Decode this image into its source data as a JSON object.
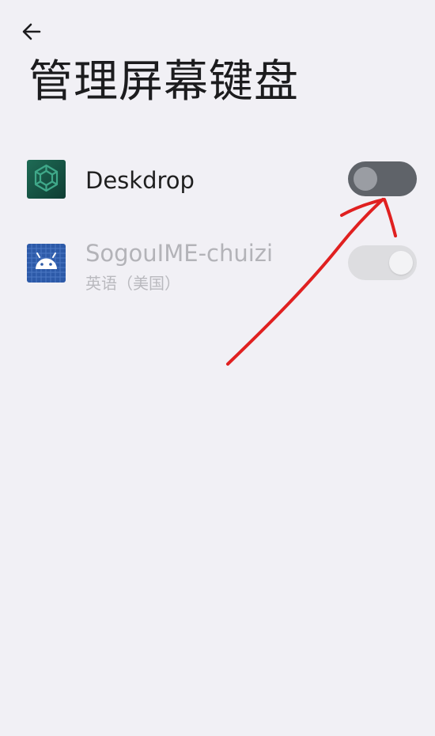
{
  "page": {
    "title": "管理屏幕键盘"
  },
  "keyboards": [
    {
      "name": "Deskdrop",
      "subtitle": "",
      "toggle_state": "off",
      "enabled": true
    },
    {
      "name": "SogouIME-chuizi",
      "subtitle": "英语（美国）",
      "toggle_state": "off",
      "enabled": false
    }
  ],
  "colors": {
    "background": "#f1f0f5",
    "toggle_active_track": "#5f6369",
    "toggle_disabled_track": "#dddde0",
    "annotation_arrow": "#e02020"
  },
  "icons": {
    "back": "arrow-left-icon",
    "deskdrop": "deskdrop-app-icon",
    "sogou": "android-robot-icon"
  }
}
